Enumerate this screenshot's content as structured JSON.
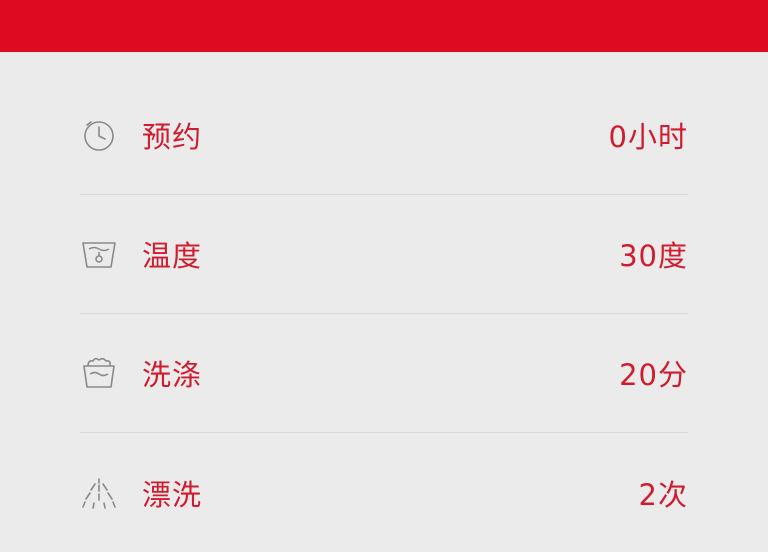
{
  "settings": {
    "rows": [
      {
        "icon": "clock-icon",
        "label": "预约",
        "value": "0小时"
      },
      {
        "icon": "temperature-tub-icon",
        "label": "温度",
        "value": "30度"
      },
      {
        "icon": "wash-tub-icon",
        "label": "洗涤",
        "value": "20分"
      },
      {
        "icon": "rinse-shower-icon",
        "label": "漂洗",
        "value": "2次"
      }
    ]
  },
  "colors": {
    "header": "#dc0b22",
    "accent": "#d01c2e",
    "background": "#ebebeb",
    "icon": "#8a8a8a",
    "divider": "#d8d8d8"
  }
}
